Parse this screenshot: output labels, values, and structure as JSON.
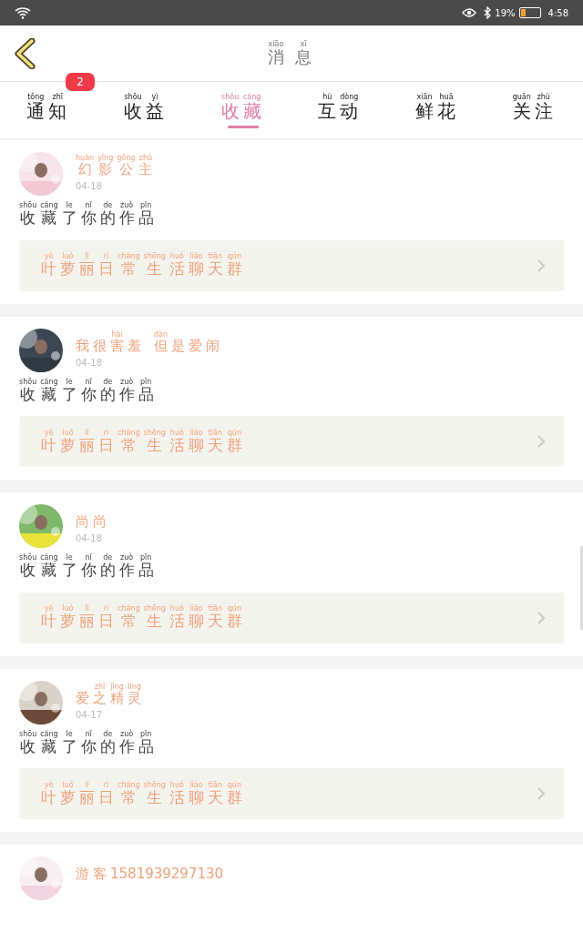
{
  "status_bar": {
    "battery_text": "19%",
    "time": "4:58"
  },
  "header": {
    "title": [
      {
        "py": "xiāo",
        "char": "消"
      },
      {
        "py": "xī",
        "char": "息"
      }
    ]
  },
  "tabs": [
    {
      "label": [
        {
          "py": "tōng",
          "char": "通"
        },
        {
          "py": "zhī",
          "char": "知"
        }
      ],
      "selected": false,
      "badge": "2"
    },
    {
      "label": [
        {
          "py": "shōu",
          "char": "收"
        },
        {
          "py": "yì",
          "char": "益"
        }
      ],
      "selected": false
    },
    {
      "label": [
        {
          "py": "shōu",
          "char": "收"
        },
        {
          "py": "cáng",
          "char": "藏"
        }
      ],
      "selected": true
    },
    {
      "label": [
        {
          "py": "hù",
          "char": "互"
        },
        {
          "py": "dòng",
          "char": "动"
        }
      ],
      "selected": false
    },
    {
      "label": [
        {
          "py": "xiān",
          "char": "鲜"
        },
        {
          "py": "huā",
          "char": "花"
        }
      ],
      "selected": false
    },
    {
      "label": [
        {
          "py": "guān",
          "char": "关"
        },
        {
          "py": "zhù",
          "char": "注"
        }
      ],
      "selected": false
    }
  ],
  "messages": [
    {
      "avatar": {
        "kind": "picture"
      },
      "name": [
        [
          {
            "py": "huàn",
            "char": "幻"
          },
          {
            "py": "yǐng",
            "char": "影"
          },
          {
            "py": "gōng",
            "char": "公"
          },
          {
            "py": "zhǔ",
            "char": "主"
          }
        ]
      ],
      "date": "04-18",
      "action": [
        {
          "py": "shōu",
          "char": "收"
        },
        {
          "py": "cáng",
          "char": "藏"
        },
        {
          "py": "le",
          "char": "了"
        },
        {
          "py": "nǐ",
          "char": "你"
        },
        {
          "py": "de",
          "char": "的"
        },
        {
          "py": "zuò",
          "char": "作"
        },
        {
          "py": "pǐn",
          "char": "品"
        }
      ],
      "group": [
        {
          "py": "yè",
          "char": "叶"
        },
        {
          "py": "luó",
          "char": "萝"
        },
        {
          "py": "lì",
          "char": "丽"
        },
        {
          "py": "rì",
          "char": "日"
        },
        {
          "py": "cháng",
          "char": "常"
        },
        {
          "py": "shēng",
          "char": "生"
        },
        {
          "py": "huó",
          "char": "活"
        },
        {
          "py": "liáo",
          "char": "聊"
        },
        {
          "py": "tiān",
          "char": "天"
        },
        {
          "py": "qún",
          "char": "群"
        }
      ]
    },
    {
      "avatar": {
        "kind": "picture"
      },
      "name": [
        [
          {
            "char": "我"
          },
          {
            "char": "很"
          },
          {
            "py": "hài",
            "char": "害"
          },
          {
            "char": "羞"
          }
        ],
        [
          {
            "py": "dàn",
            "char": "但"
          },
          {
            "char": "是"
          },
          {
            "char": "爱"
          },
          {
            "char": "闹"
          }
        ]
      ],
      "date": "04-18",
      "action": [
        {
          "py": "shōu",
          "char": "收"
        },
        {
          "py": "cáng",
          "char": "藏"
        },
        {
          "py": "le",
          "char": "了"
        },
        {
          "py": "nǐ",
          "char": "你"
        },
        {
          "py": "de",
          "char": "的"
        },
        {
          "py": "zuò",
          "char": "作"
        },
        {
          "py": "pǐn",
          "char": "品"
        }
      ],
      "group": [
        {
          "py": "yè",
          "char": "叶"
        },
        {
          "py": "luó",
          "char": "萝"
        },
        {
          "py": "lì",
          "char": "丽"
        },
        {
          "py": "rì",
          "char": "日"
        },
        {
          "py": "cháng",
          "char": "常"
        },
        {
          "py": "shēng",
          "char": "生"
        },
        {
          "py": "huó",
          "char": "活"
        },
        {
          "py": "liáo",
          "char": "聊"
        },
        {
          "py": "tiān",
          "char": "天"
        },
        {
          "py": "qún",
          "char": "群"
        }
      ]
    },
    {
      "avatar": {
        "kind": "picture"
      },
      "name": [
        [
          {
            "char": "尚"
          },
          {
            "char": "尚"
          }
        ]
      ],
      "date": "04-18",
      "action": [
        {
          "py": "shōu",
          "char": "收"
        },
        {
          "py": "cáng",
          "char": "藏"
        },
        {
          "py": "le",
          "char": "了"
        },
        {
          "py": "nǐ",
          "char": "你"
        },
        {
          "py": "de",
          "char": "的"
        },
        {
          "py": "zuò",
          "char": "作"
        },
        {
          "py": "pǐn",
          "char": "品"
        }
      ],
      "group": [
        {
          "py": "yè",
          "char": "叶"
        },
        {
          "py": "luó",
          "char": "萝"
        },
        {
          "py": "lì",
          "char": "丽"
        },
        {
          "py": "rì",
          "char": "日"
        },
        {
          "py": "cháng",
          "char": "常"
        },
        {
          "py": "shēng",
          "char": "生"
        },
        {
          "py": "huó",
          "char": "活"
        },
        {
          "py": "liáo",
          "char": "聊"
        },
        {
          "py": "tiān",
          "char": "天"
        },
        {
          "py": "qún",
          "char": "群"
        }
      ]
    },
    {
      "avatar": {
        "kind": "picture"
      },
      "name": [
        [
          {
            "char": "爱"
          },
          {
            "py": "zhī",
            "char": "之"
          },
          {
            "py": "jīng",
            "char": "精"
          },
          {
            "py": "líng",
            "char": "灵"
          }
        ]
      ],
      "date": "04-17",
      "action": [
        {
          "py": "shōu",
          "char": "收"
        },
        {
          "py": "cáng",
          "char": "藏"
        },
        {
          "py": "le",
          "char": "了"
        },
        {
          "py": "nǐ",
          "char": "你"
        },
        {
          "py": "de",
          "char": "的"
        },
        {
          "py": "zuò",
          "char": "作"
        },
        {
          "py": "pǐn",
          "char": "品"
        }
      ],
      "group": [
        {
          "py": "yè",
          "char": "叶"
        },
        {
          "py": "luó",
          "char": "萝"
        },
        {
          "py": "lì",
          "char": "丽"
        },
        {
          "py": "rì",
          "char": "日"
        },
        {
          "py": "cháng",
          "char": "常"
        },
        {
          "py": "shēng",
          "char": "生"
        },
        {
          "py": "huó",
          "char": "活"
        },
        {
          "py": "liáo",
          "char": "聊"
        },
        {
          "py": "tiān",
          "char": "天"
        },
        {
          "py": "qún",
          "char": "群"
        }
      ]
    },
    {
      "avatar": {
        "kind": "picture"
      },
      "name": [
        [
          {
            "char": "游"
          },
          {
            "char": "客"
          },
          {
            "char": "1581939297130"
          }
        ]
      ]
    }
  ]
}
